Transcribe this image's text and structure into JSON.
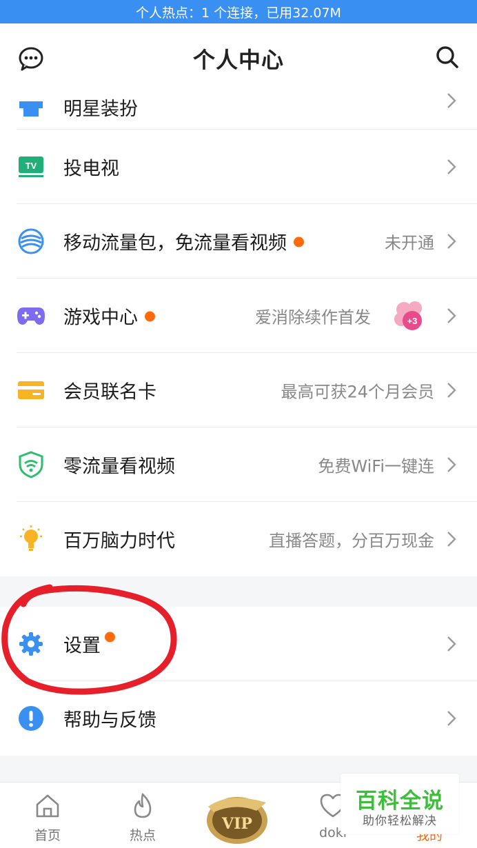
{
  "status_bar": {
    "hotspot_text": "个人热点：1 个连接，已用32.07M"
  },
  "header": {
    "title": "个人中心"
  },
  "menu": [
    {
      "label": "明星装扮",
      "right_text": "",
      "dot": false
    },
    {
      "label": "投电视",
      "right_text": "",
      "dot": false
    },
    {
      "label": "移动流量包，免流量看视频",
      "right_text": "未开通",
      "dot": true
    },
    {
      "label": "游戏中心",
      "right_text": "爱消除续作首发",
      "dot": true
    },
    {
      "label": "会员联名卡",
      "right_text": "最高可获24个月会员",
      "dot": false
    },
    {
      "label": "零流量看视频",
      "right_text": "免费WiFi一键连",
      "dot": false
    },
    {
      "label": "百万脑力时代",
      "right_text": "直播答题，分百万现金",
      "dot": false
    }
  ],
  "menu2": [
    {
      "label": "设置",
      "dot": true
    },
    {
      "label": "帮助与反馈",
      "dot": false
    }
  ],
  "tabs": [
    {
      "label": "首页"
    },
    {
      "label": "热点"
    },
    {
      "label": "doki"
    },
    {
      "label": "我的"
    }
  ],
  "vip_badge_text": "VIP",
  "game_badge_text": "+3",
  "watermark": {
    "title": "百科全说",
    "subtitle": "助你轻松解决"
  },
  "colors": {
    "accent_blue": "#3a8ff2",
    "dot_orange": "#ff6a0b",
    "annotation_red": "#e5202a",
    "watermark_green": "#3bbf3b"
  }
}
